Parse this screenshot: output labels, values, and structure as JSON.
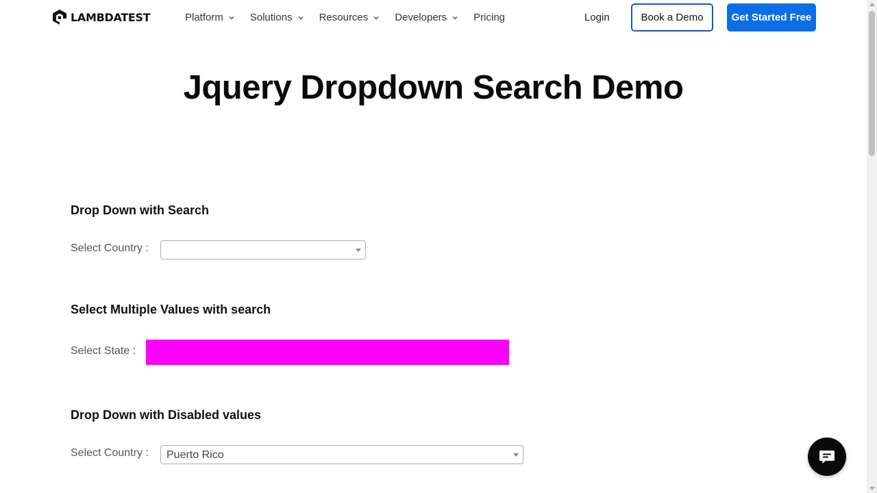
{
  "header": {
    "logo_text": "LAMBDATEST",
    "nav": [
      {
        "label": "Platform",
        "has_dropdown": true
      },
      {
        "label": "Solutions",
        "has_dropdown": true
      },
      {
        "label": "Resources",
        "has_dropdown": true
      },
      {
        "label": "Developers",
        "has_dropdown": true
      },
      {
        "label": "Pricing",
        "has_dropdown": false
      }
    ],
    "login_label": "Login",
    "book_demo_label": "Book a Demo",
    "get_started_label": "Get Started Free",
    "accent_color": "#0b6ee6"
  },
  "page": {
    "title": "Jquery Dropdown Search Demo"
  },
  "sections": [
    {
      "title": "Drop Down with Search",
      "field_label": "Select Country :",
      "selected_value": ""
    },
    {
      "title": "Select Multiple Values with search",
      "field_label": "Select State :",
      "selected_value": "",
      "highlight_color": "#ff00ff"
    },
    {
      "title": "Drop Down with Disabled values",
      "field_label": "Select Country :",
      "selected_value": "Puerto Rico"
    }
  ],
  "icons": {
    "chat": "chat-bubble-icon",
    "dropdown": "chevron-down-icon"
  }
}
